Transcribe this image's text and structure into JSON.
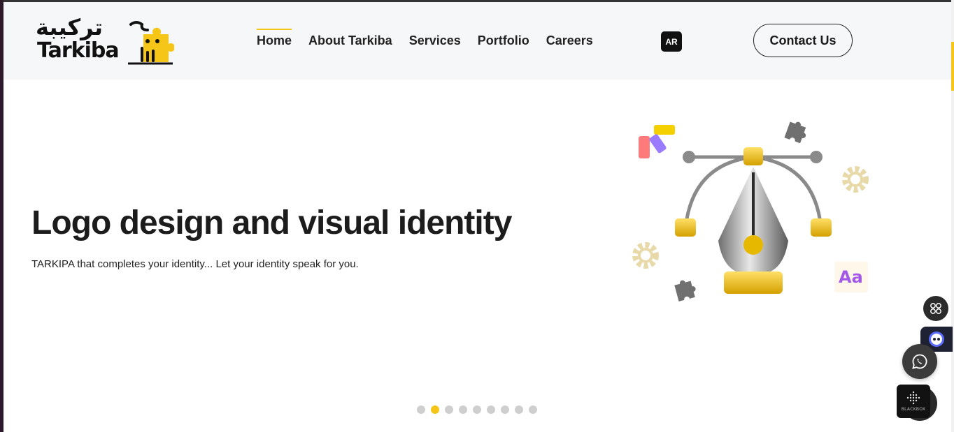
{
  "brand": {
    "logo_ar": "تركيبة",
    "logo_en": "Tarkiba",
    "accent_color": "#f5c518"
  },
  "nav": {
    "items": [
      {
        "label": "Home",
        "active": true
      },
      {
        "label": "About Tarkiba",
        "active": false
      },
      {
        "label": "Services",
        "active": false
      },
      {
        "label": "Portfolio",
        "active": false
      },
      {
        "label": "Careers",
        "active": false
      }
    ],
    "lang_toggle": "AR",
    "contact_label": "Contact Us"
  },
  "hero": {
    "title": "Logo design and visual identity",
    "subtitle": "TARKIPA that completes your identity... Let your identity speak for you.",
    "illustration_badge": "Aa"
  },
  "slider": {
    "total_slides": 9,
    "active_index": 1
  },
  "floating": {
    "apps_icon": "grid-icon",
    "chat_icon": "bot-face-icon",
    "whatsapp_icon": "whatsapp-icon",
    "blackbox_label": "BLACKBOX"
  }
}
